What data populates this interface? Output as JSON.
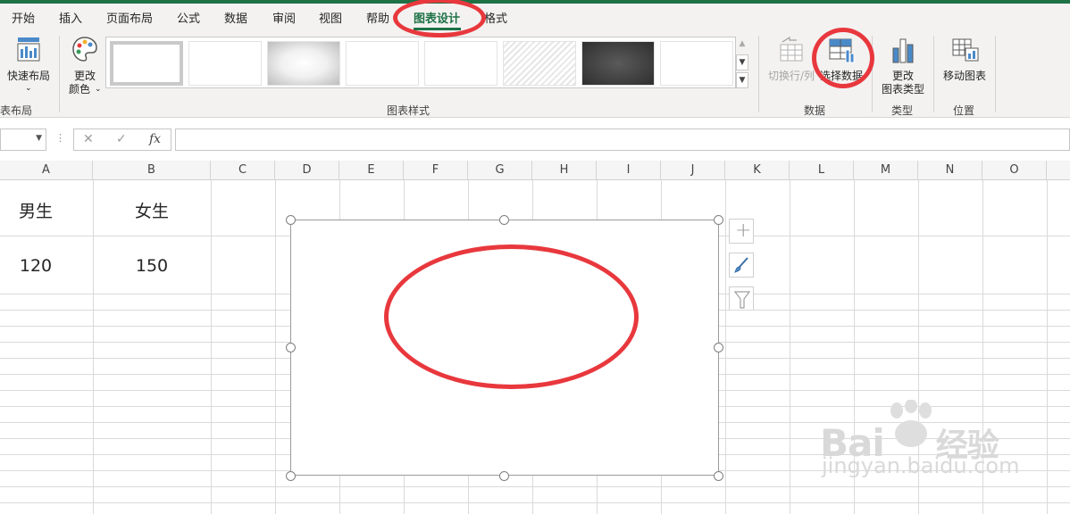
{
  "menu": {
    "tabs": [
      {
        "label": "开始"
      },
      {
        "label": "插入"
      },
      {
        "label": "页面布局"
      },
      {
        "label": "公式"
      },
      {
        "label": "数据"
      },
      {
        "label": "审阅"
      },
      {
        "label": "视图"
      },
      {
        "label": "帮助"
      },
      {
        "label": "图表设计"
      },
      {
        "label": "格式"
      }
    ],
    "active_tab": "图表设计"
  },
  "ribbon": {
    "quick_layout_label": "快速布局",
    "change_colors_line1": "更改",
    "change_colors_line2": "颜色",
    "switch_row_col_label": "切换行/列",
    "select_data_label": "选择数据",
    "change_type_line1": "更改",
    "change_type_line2": "图表类型",
    "move_chart_label": "移动图表",
    "groups": {
      "chart_layouts": "表布局",
      "chart_styles": "图表样式",
      "data": "数据",
      "type": "类型",
      "location": "位置"
    }
  },
  "formula_bar": {
    "cancel": "✕",
    "enter": "✓",
    "fx": "fx"
  },
  "columns": [
    "A",
    "B",
    "C",
    "D",
    "E",
    "F",
    "G",
    "H",
    "I",
    "J",
    "K",
    "L",
    "M",
    "N",
    "O"
  ],
  "cells": {
    "A1": "男生",
    "B1": "女生",
    "A2": "120",
    "B2": "150"
  },
  "chart_tools": {
    "add_element": "+"
  },
  "colors": {
    "accent": "#1e7145",
    "annotation": "#e8383d"
  },
  "icons": [
    "quick-layout-icon",
    "palette-icon",
    "switch-row-column-icon",
    "select-data-icon",
    "change-chart-type-icon",
    "move-chart-icon",
    "plus-icon",
    "brush-icon",
    "filter-icon"
  ]
}
